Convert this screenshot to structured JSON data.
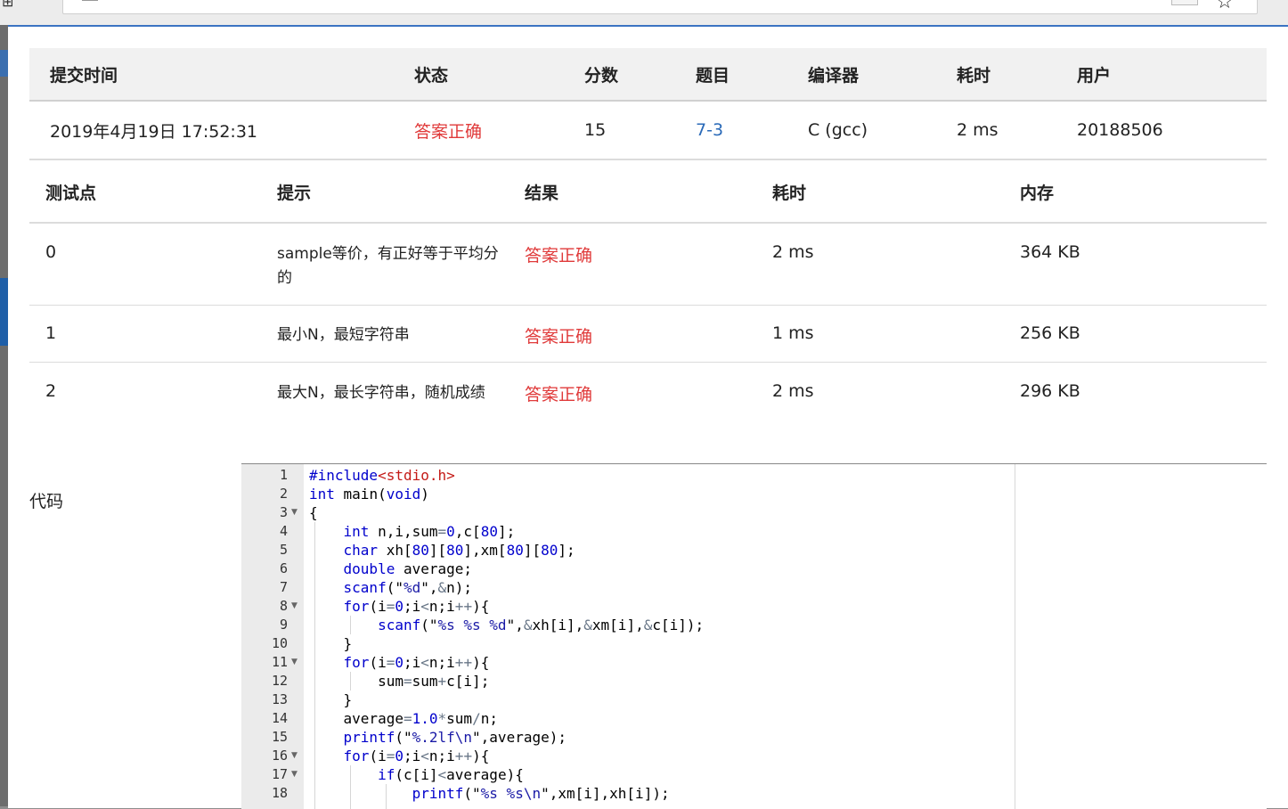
{
  "summary": {
    "headers": [
      "提交时间",
      "状态",
      "分数",
      "题目",
      "编译器",
      "耗时",
      "用户"
    ],
    "submit_time": "2019年4月19日 17:52:31",
    "status": "答案正确",
    "score": "15",
    "problem": "7-3",
    "compiler": "C (gcc)",
    "time": "2 ms",
    "user": "20188506"
  },
  "cases": {
    "headers": [
      "测试点",
      "提示",
      "结果",
      "耗时",
      "内存"
    ],
    "rows": [
      {
        "id": "0",
        "hint": "sample等价，有正好等于平均分的",
        "result": "答案正确",
        "time": "2 ms",
        "memory": "364 KB"
      },
      {
        "id": "1",
        "hint": "最小N，最短字符串",
        "result": "答案正确",
        "time": "1 ms",
        "memory": "256 KB"
      },
      {
        "id": "2",
        "hint": "最大N，最长字符串，随机成绩",
        "result": "答案正确",
        "time": "2 ms",
        "memory": "296 KB"
      }
    ]
  },
  "code_label": "代码",
  "code": {
    "line_numbers": [
      "1",
      "2",
      "3",
      "4",
      "5",
      "6",
      "7",
      "8",
      "9",
      "10",
      "11",
      "12",
      "13",
      "14",
      "15",
      "16",
      "17",
      "18"
    ],
    "lines": [
      "#include<stdio.h>",
      "int main(void)",
      "{",
      "    int n,i,sum=0,c[80];",
      "    char xh[80][80],xm[80][80];",
      "    double average;",
      "    scanf(\"%d\",&n);",
      "    for(i=0;i<n;i++){",
      "        scanf(\"%s %s %d\",&xh[i],&xm[i],&c[i]);",
      "    }",
      "    for(i=0;i<n;i++){",
      "        sum=sum+c[i];",
      "    }",
      "    average=1.0*sum/n;",
      "    printf(\"%.2lf\\n\",average);",
      "    for(i=0;i<n;i++){",
      "        if(c[i]<average){",
      "            printf(\"%s %s\\n\",xm[i],xh[i]);"
    ],
    "foldable_lines": [
      "3",
      "8",
      "11",
      "16",
      "17"
    ]
  },
  "colors": {
    "status_ok": "#e03a3a",
    "link": "#2a6ab8",
    "keyword": "#0000cc",
    "include": "#c41a16"
  },
  "icons": [
    "bookmark-star-icon",
    "fold-arrow-icon"
  ]
}
